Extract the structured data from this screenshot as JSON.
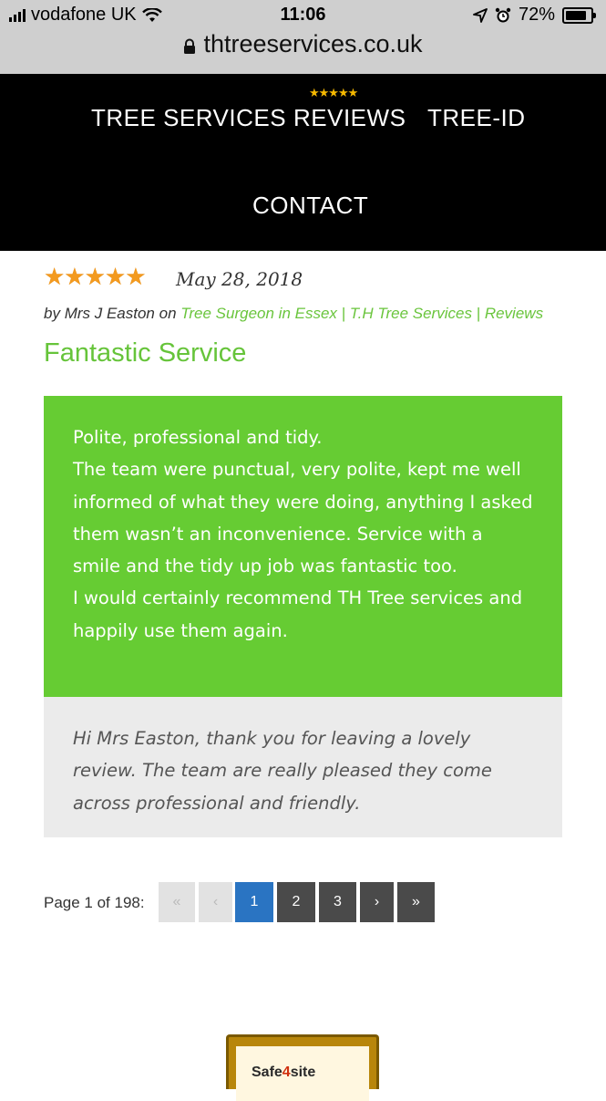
{
  "status_bar": {
    "carrier": "vodafone UK",
    "time": "11:06",
    "battery": "72%"
  },
  "url_bar": {
    "url": "thtreeservices.co.uk"
  },
  "nav": {
    "items": [
      "TREE SERVICES",
      "REVIEWS",
      "TREE-ID",
      "CONTACT"
    ],
    "reviews_stars": "★★★★★"
  },
  "review": {
    "stars": "★★★★★",
    "rating": 5,
    "date": "May 28, 2018",
    "by_prefix": "by ",
    "author": "Mrs J Easton",
    "on_text": " on ",
    "link_1": "Tree Surgeon in Essex",
    "separator": " | ",
    "link_2": "T.H Tree Services",
    "link_3": "Reviews",
    "title": "Fantastic Service",
    "body_lines": [
      "Polite, professional and tidy.",
      "The team were punctual, very polite, kept me well informed of what they were doing, anything I asked them wasn’t an inconvenience. Service with a smile and the tidy up job was fantastic too.",
      "I would certainly recommend TH Tree services and happily use them again."
    ],
    "reply": "Hi Mrs Easton, thank you for leaving a lovely review. The team are really pleased they come across professional and friendly."
  },
  "pagination": {
    "info": "Page 1 of 198:",
    "first": "«",
    "prev": "‹",
    "pages": [
      "1",
      "2",
      "3"
    ],
    "next": "›",
    "last": "»"
  },
  "badge": {
    "text_a": "Safe",
    "text_b": "4",
    "text_c": "site"
  },
  "colors": {
    "accent_green": "#66cc33",
    "title_green": "#66c43a",
    "active_page": "#2a74c2",
    "star_orange": "#f39a1f"
  }
}
